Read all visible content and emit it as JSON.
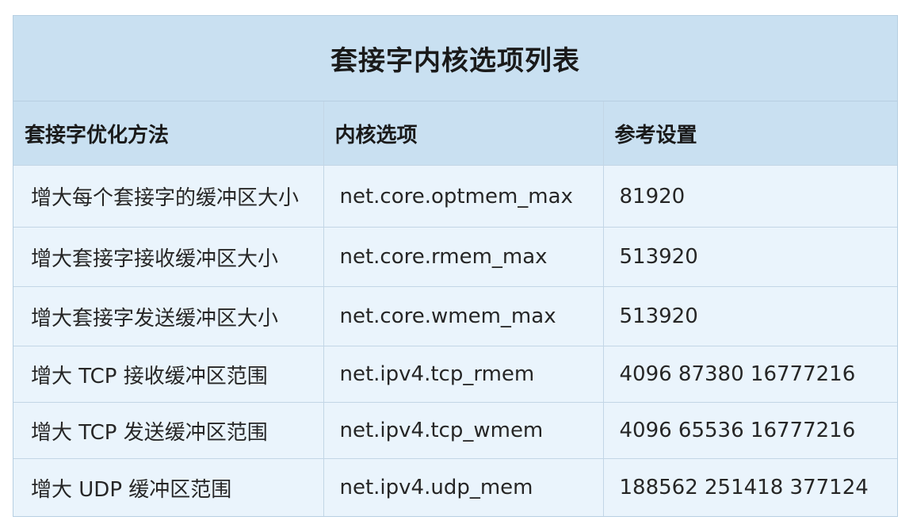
{
  "title": "套接字内核选项列表",
  "headers": [
    "套接字优化方法",
    "内核选项",
    "参考设置"
  ],
  "rows": [
    {
      "method": "增大每个套接字的缓冲区大小",
      "option": "net.core.optmem_max",
      "value": "81920"
    },
    {
      "method": "增大套接字接收缓冲区大小",
      "option": "net.core.rmem_max",
      "value": "513920"
    },
    {
      "method": "增大套接字发送缓冲区大小",
      "option": "net.core.wmem_max",
      "value": "513920"
    },
    {
      "method": "增大 TCP 接收缓冲区范围",
      "option": "net.ipv4.tcp_rmem",
      "value": "4096 87380 16777216"
    },
    {
      "method": "增大 TCP 发送缓冲区范围",
      "option": "net.ipv4.tcp_wmem",
      "value": "4096 65536 16777216"
    },
    {
      "method": "增大 UDP 缓冲区范围",
      "option": "net.ipv4.udp_mem",
      "value": "188562 251418 377124"
    }
  ],
  "colors": {
    "header_bg": "#c9e0f1",
    "row_bg": "#eaf4fc",
    "border": "#c3d6e6"
  }
}
